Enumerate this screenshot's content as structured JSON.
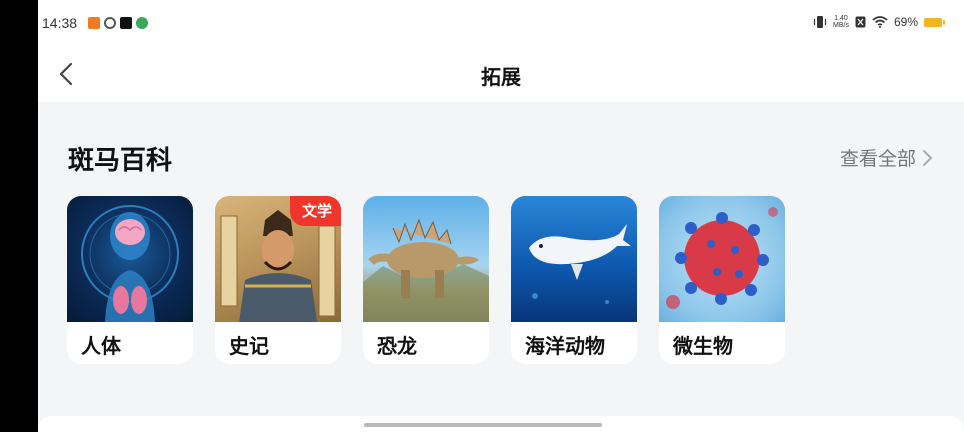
{
  "status_bar": {
    "time": "14:38",
    "net_speed_value": "1.40",
    "net_speed_unit": "MB/s",
    "battery": "69%"
  },
  "header": {
    "title": "拓展"
  },
  "section": {
    "title": "斑马百科",
    "view_all": "查看全部"
  },
  "cards": [
    {
      "label": "人体",
      "tag": ""
    },
    {
      "label": "史记",
      "tag": "文学"
    },
    {
      "label": "恐龙",
      "tag": ""
    },
    {
      "label": "海洋动物",
      "tag": ""
    },
    {
      "label": "微生物",
      "tag": ""
    }
  ],
  "colors": {
    "tag": "#f0362a",
    "battery": "#f2b51f",
    "background": "#f4f5f7"
  }
}
